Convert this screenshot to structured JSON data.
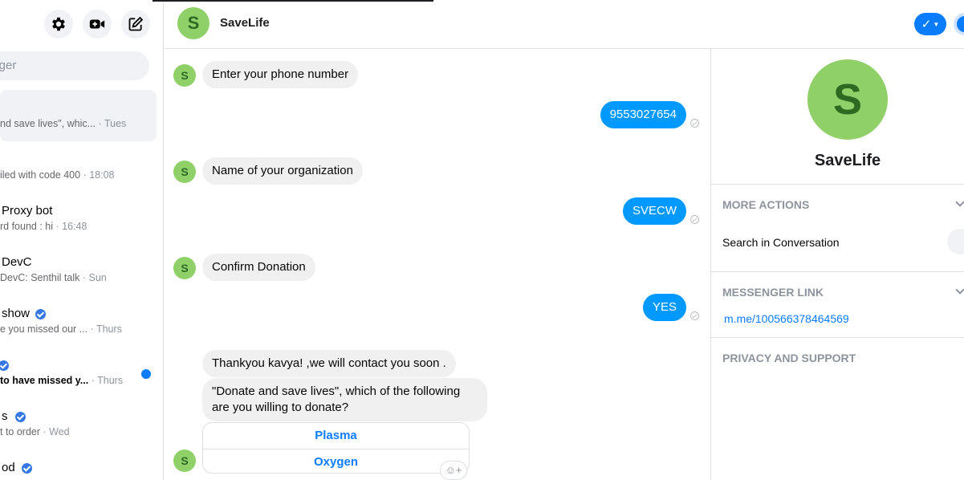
{
  "left_panel": {
    "search_placeholder": "enger",
    "conversations": [
      {
        "line1": "",
        "line2": "nd save lives\", whic...",
        "time": "· Tues",
        "bold": false,
        "verified": false
      },
      {
        "line1": "",
        "line2": "iled with code 400",
        "time": "· 18:08",
        "bold": false,
        "verified": false
      },
      {
        "line1": "Proxy bot",
        "line2": "rd found : hi",
        "time": "· 16:48",
        "bold": false,
        "verified": false
      },
      {
        "line1": "DevC",
        "line2": "DevC: Senthil talk",
        "time": "· Sun",
        "bold": false,
        "verified": false
      },
      {
        "line1": "show",
        "line2": "e you missed our ...",
        "time": "· Thurs",
        "bold": false,
        "verified": true
      },
      {
        "line1": "",
        "line2": "to have missed y...",
        "time": "· Thurs",
        "bold": true,
        "verified": true
      },
      {
        "line1": "s",
        "line2": "t to order",
        "time": "· Wed",
        "bold": false,
        "verified": true
      },
      {
        "line1": "od",
        "line2": "",
        "time": "",
        "bold": false,
        "verified": true
      }
    ]
  },
  "chat": {
    "title": "SaveLife",
    "avatar_letter": "S",
    "messages": {
      "m1": "Enter your phone number",
      "m2": "9553027654",
      "m3": "Name of your organization",
      "m4": "SVECW",
      "m5": "Confirm Donation",
      "m6": "YES",
      "m7": "Thankyou kavya! ,we will contact you soon .",
      "m8": "\"Donate and save lives\", which of the following are you willing to donate?"
    },
    "quick_replies": [
      "Plasma",
      "Oxygen"
    ]
  },
  "right_panel": {
    "name": "SaveLife",
    "avatar_letter": "S",
    "more_actions": "MORE ACTIONS",
    "search_in_conversation": "Search in Conversation",
    "messenger_link_title": "MESSENGER LINK",
    "messenger_link": "m.me/100566378464569",
    "privacy_support": "PRIVACY AND SUPPORT"
  },
  "colors": {
    "accent": "#0099ff",
    "avatar_bg": "#8fd069",
    "avatar_fg": "#2d6b22"
  }
}
